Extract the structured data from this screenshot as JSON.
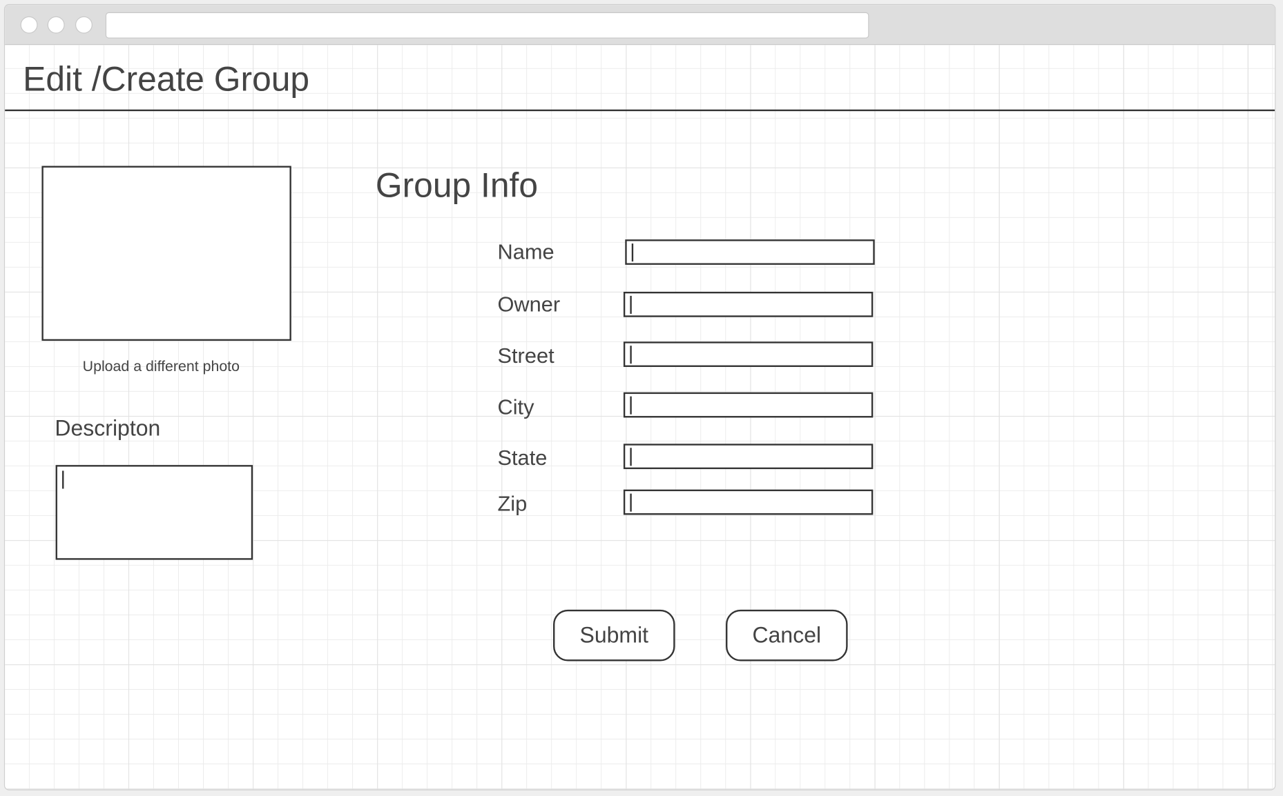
{
  "page_title": "Edit /Create Group",
  "photo": {
    "upload_link": "Upload a different photo"
  },
  "description": {
    "label": "Descripton",
    "value": ""
  },
  "group_info": {
    "heading": "Group Info",
    "fields": [
      {
        "label": "Name",
        "value": ""
      },
      {
        "label": "Owner",
        "value": ""
      },
      {
        "label": "Street",
        "value": ""
      },
      {
        "label": "City",
        "value": ""
      },
      {
        "label": "State",
        "value": ""
      },
      {
        "label": "Zip",
        "value": ""
      }
    ]
  },
  "buttons": {
    "submit": "Submit",
    "cancel": "Cancel"
  }
}
